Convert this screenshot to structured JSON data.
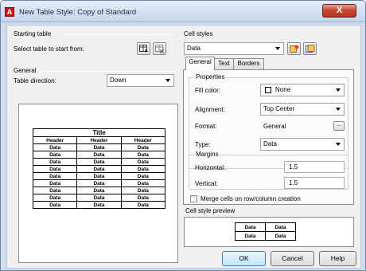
{
  "window": {
    "app_icon_letter": "A",
    "title": "New Table Style: Copy of Standard",
    "close_glyph": "X"
  },
  "starting_table": {
    "group_label": "Starting table",
    "prompt": "Select table to start from:"
  },
  "general": {
    "group_label": "General",
    "direction_label": "Table direction:",
    "direction_value": "Down"
  },
  "preview_table": {
    "title": "Title",
    "headers": [
      "Header",
      "Header",
      "Header"
    ],
    "rows": [
      [
        "Data",
        "Data",
        "Data"
      ],
      [
        "Data",
        "Data",
        "Data"
      ],
      [
        "Data",
        "Data",
        "Data"
      ],
      [
        "Data",
        "Data",
        "Data"
      ],
      [
        "Data",
        "Data",
        "Data"
      ],
      [
        "Data",
        "Data",
        "Data"
      ],
      [
        "Data",
        "Data",
        "Data"
      ],
      [
        "Data",
        "Data",
        "Data"
      ],
      [
        "Data",
        "Data",
        "Data"
      ]
    ]
  },
  "cell_styles": {
    "group_label": "Cell styles",
    "selected": "Data"
  },
  "tabs": [
    {
      "label": "General",
      "active": true
    },
    {
      "label": "Text",
      "active": false
    },
    {
      "label": "Borders",
      "active": false
    }
  ],
  "properties": {
    "group_label": "Properties",
    "fill_color_label": "Fill color:",
    "fill_color_value": "None",
    "alignment_label": "Alignment:",
    "alignment_value": "Top Center",
    "format_label": "Format:",
    "format_value": "General",
    "format_button": "...",
    "type_label": "Type:",
    "type_value": "Data"
  },
  "margins": {
    "group_label": "Margins",
    "horizontal_label": "Horizontal:",
    "horizontal_value": "1.5",
    "vertical_label": "Vertical:",
    "vertical_value": "1.5"
  },
  "merge": {
    "label": "Merge cells on row/column creation",
    "checked": false
  },
  "cell_style_preview": {
    "label": "Cell style preview",
    "rows": [
      [
        "Data",
        "Data"
      ],
      [
        "Data",
        "Data"
      ]
    ]
  },
  "buttons": {
    "ok": "OK",
    "cancel": "Cancel",
    "help": "Help"
  },
  "colors": {
    "title_bar": "#c6d6ea",
    "close_button": "#c74a35",
    "dialog_bg": "#f0f0f0",
    "ok_focus": "#bee6fd"
  }
}
